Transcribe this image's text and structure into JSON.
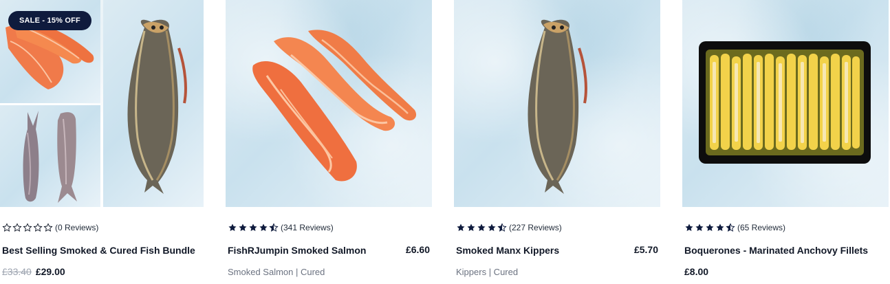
{
  "colors": {
    "badge_bg": "#0f1b3d",
    "star_filled": "#0f1b3d",
    "star_empty": "#111827",
    "text_primary": "#111827",
    "text_muted": "#6b7280",
    "price_old": "#9ca3af"
  },
  "products": [
    {
      "badge": "SALE - 15% OFF",
      "rating": 0,
      "reviews_label": "(0 Reviews)",
      "title": "Best Selling Smoked & Cured Fish Bundle",
      "price_old": "£33.40",
      "price": "£29.00",
      "image_icon": "fish-bundle-collage"
    },
    {
      "rating": 4.5,
      "reviews_label": "(341 Reviews)",
      "title": "FishRJumpin Smoked Salmon",
      "price": "£6.60",
      "subtitle": "Smoked Salmon | Cured",
      "image_icon": "smoked-salmon-image"
    },
    {
      "rating": 4.5,
      "reviews_label": "(227 Reviews)",
      "title": "Smoked Manx Kippers",
      "price": "£5.70",
      "subtitle": "Kippers | Cured",
      "image_icon": "kippers-image"
    },
    {
      "rating": 4.5,
      "reviews_label": "(65 Reviews)",
      "title": "Boquerones - Marinated Anchovy Fillets",
      "price": "£8.00",
      "image_icon": "anchovy-tray-image"
    }
  ]
}
